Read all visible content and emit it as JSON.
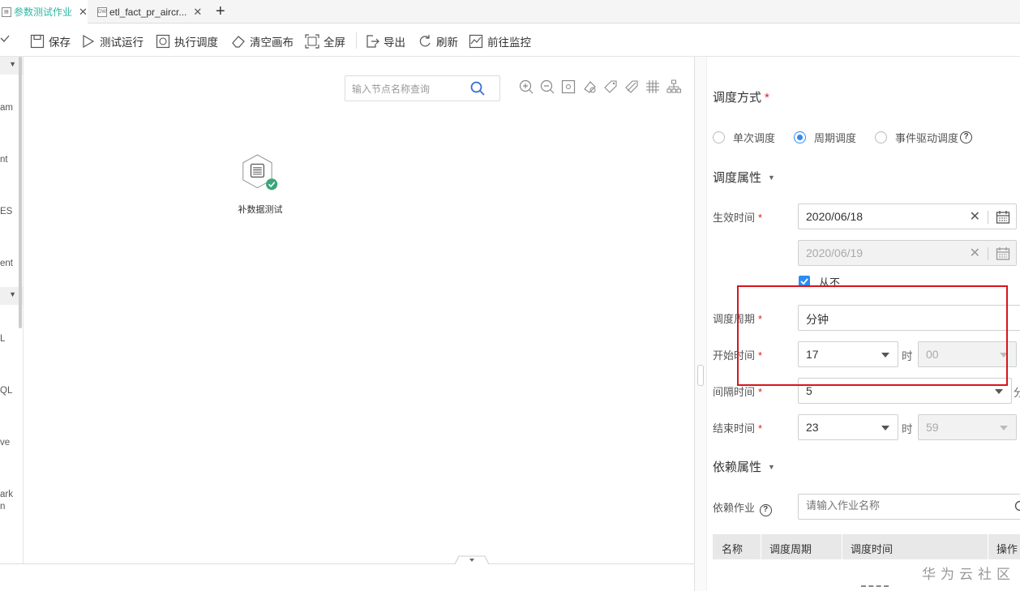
{
  "tabs": [
    {
      "icon": "job-icon",
      "label": "参数测试作业",
      "active": true
    },
    {
      "icon": "dw-icon",
      "icon_text": "DW",
      "label": "etl_fact_pr_aircr..."
    }
  ],
  "toolbar": {
    "save": "保存",
    "test_run": "测试运行",
    "schedule": "执行调度",
    "clear_canvas": "清空画布",
    "fullscreen": "全屏",
    "export": "导出",
    "refresh": "刷新",
    "monitor": "前往监控"
  },
  "left_panel": {
    "items": [
      "am",
      "nt",
      "ES",
      "ent",
      "L",
      "QL",
      "ve",
      "ark",
      "n"
    ]
  },
  "canvas": {
    "search_placeholder": "输入节点名称查询",
    "node_label": "补数据测试"
  },
  "schedule": {
    "mode_label": "调度方式",
    "modes": [
      "单次调度",
      "周期调度",
      "事件驱动调度"
    ],
    "selected_mode": "周期调度",
    "props_title": "调度属性",
    "effective_label": "生效时间",
    "effective_start": "2020/06/18",
    "effective_end": "2020/06/19",
    "never_label": "从不",
    "never_checked": true,
    "period_label": "调度周期",
    "period_value": "分钟",
    "start_label": "开始时间",
    "start_hour": "17",
    "start_minute": "00",
    "interval_label": "间隔时间",
    "interval_value": "5",
    "interval_unit": "分",
    "end_label": "结束时间",
    "end_hour": "23",
    "end_minute": "59",
    "hour_unit": "时"
  },
  "dependency": {
    "title": "依赖属性",
    "job_label": "依赖作业",
    "job_placeholder": "请输入作业名称",
    "columns": [
      "名称",
      "调度周期",
      "调度时间",
      "操作"
    ]
  },
  "watermark": "华为云社区",
  "colors": {
    "accent": "#2d8cf0",
    "tab_active": "#2db7a4",
    "highlight": "#d8141c",
    "success": "#3aa57a"
  }
}
